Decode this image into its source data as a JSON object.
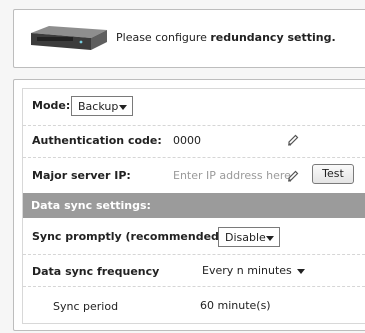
{
  "header": {
    "message_prefix": "Please configure ",
    "message_bold": "redundancy setting."
  },
  "settings": {
    "mode": {
      "label": "Mode:",
      "value": "Backup"
    },
    "auth": {
      "label": "Authentication code:",
      "value": "0000"
    },
    "server_ip": {
      "label": "Major server IP:",
      "placeholder": "Enter IP address here",
      "test_label": "Test"
    },
    "section_title": "Data sync settings:",
    "sync_promptly": {
      "label": "Sync promptly (recommended)",
      "value": "Disable"
    },
    "sync_frequency": {
      "label": "Data sync frequency",
      "value": "Every n minutes"
    },
    "sync_period": {
      "label": "Sync period",
      "value": "60 minute(s)"
    }
  },
  "icons": {
    "device": "nas-device-icon",
    "edit": "pencil-icon"
  }
}
